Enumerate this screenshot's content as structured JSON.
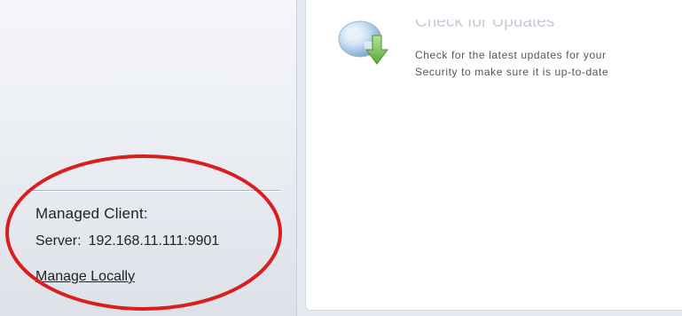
{
  "sidebar": {
    "managed_client_label": "Managed Client:",
    "server_label": "Server:",
    "server_address": "192.168.11.111:9901",
    "manage_locally_link": "Manage Locally"
  },
  "main": {
    "task": {
      "title": "Check for Updates",
      "description_line1": "Check for the latest updates for your",
      "description_line2": "Security to make sure it is up-to-date",
      "icon": "update-globe-arrow-icon"
    }
  },
  "annotation": {
    "color": "#d91e1e",
    "shape": "ellipse"
  }
}
